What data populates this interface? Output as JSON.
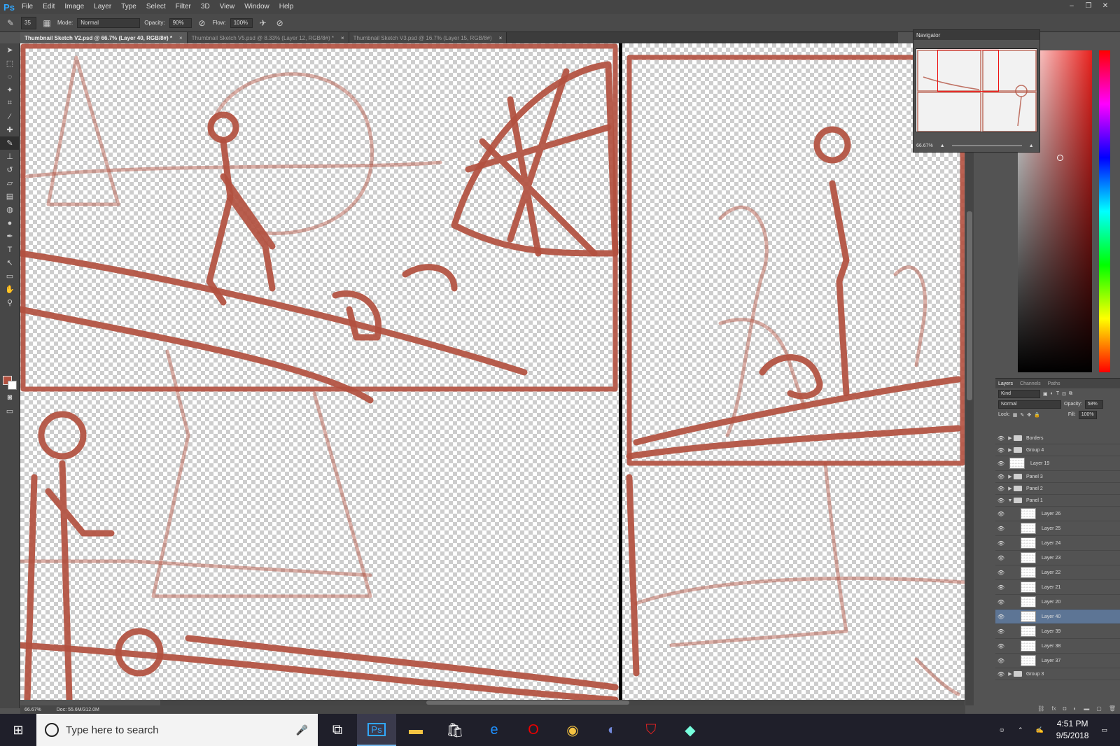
{
  "app": {
    "logo": "Ps"
  },
  "menu": [
    "File",
    "Edit",
    "Image",
    "Layer",
    "Type",
    "Select",
    "Filter",
    "3D",
    "View",
    "Window",
    "Help"
  ],
  "options": {
    "brush_size": "35",
    "mode_label": "Mode:",
    "mode_value": "Normal",
    "opacity_label": "Opacity:",
    "opacity_value": "90%",
    "flow_label": "Flow:",
    "flow_value": "100%"
  },
  "tabs": [
    {
      "label": "Thumbnail Sketch V2.psd @ 66.7% (Layer 40, RGB/8#) *",
      "active": true
    },
    {
      "label": "Thumbnail Sketch V5.psd @ 8.33% (Layer 12, RGB/8#) *",
      "active": false
    },
    {
      "label": "Thumbnail Sketch V3.psd @ 16.7% (Layer 15, RGB/8#)",
      "active": false
    }
  ],
  "status": {
    "zoom": "66.67%",
    "doc": "Doc: 55.6M/312.0M"
  },
  "navigator": {
    "title": "Navigator",
    "zoom": "66.67%"
  },
  "layers_panel": {
    "tabs": [
      "Layers",
      "Channels",
      "Paths"
    ],
    "filter": "Kind",
    "blend": "Normal",
    "opacity_label": "Opacity:",
    "opacity": "58%",
    "lock_label": "Lock:",
    "fill_label": "Fill:",
    "fill": "100%",
    "items": [
      {
        "name": "Borders",
        "type": "group",
        "caret": "▶"
      },
      {
        "name": "Group 4",
        "type": "group",
        "caret": "▶"
      },
      {
        "name": "Layer 19",
        "type": "layer"
      },
      {
        "name": "Panel 3",
        "type": "group",
        "caret": "▶"
      },
      {
        "name": "Panel 2",
        "type": "group",
        "caret": "▶"
      },
      {
        "name": "Panel 1",
        "type": "group",
        "caret": "▼"
      },
      {
        "name": "Layer 26",
        "type": "layer"
      },
      {
        "name": "Layer 25",
        "type": "layer"
      },
      {
        "name": "Layer 24",
        "type": "layer"
      },
      {
        "name": "Layer 23",
        "type": "layer"
      },
      {
        "name": "Layer 22",
        "type": "layer"
      },
      {
        "name": "Layer 21",
        "type": "layer"
      },
      {
        "name": "Layer 20",
        "type": "layer"
      },
      {
        "name": "Layer 40",
        "type": "layer",
        "selected": true
      },
      {
        "name": "Layer 39",
        "type": "layer"
      },
      {
        "name": "Layer 38",
        "type": "layer"
      },
      {
        "name": "Layer 37",
        "type": "layer"
      },
      {
        "name": "Group 3",
        "type": "group",
        "caret": "▶"
      }
    ]
  },
  "taskbar": {
    "search_placeholder": "Type here to search",
    "time": "4:51 PM",
    "date": "9/5/2018"
  },
  "colors": {
    "sketch": "#b2503f",
    "accent": "#31a8ff",
    "selected_layer": "#5d7595"
  }
}
